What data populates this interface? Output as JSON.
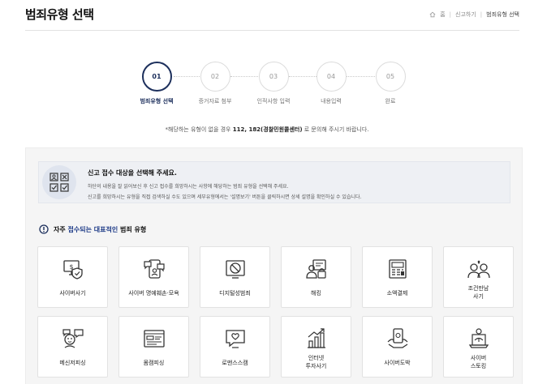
{
  "header": {
    "title": "범죄유형 선택",
    "breadcrumb": [
      "홈",
      "신고하기",
      "범죄유형 선택"
    ]
  },
  "stepper": {
    "steps": [
      {
        "number": "01",
        "label": "범죄유형 선택",
        "active": true
      },
      {
        "number": "02",
        "label": "증거자료 첨부",
        "active": false
      },
      {
        "number": "03",
        "label": "인적사항 입력",
        "active": false
      },
      {
        "number": "04",
        "label": "내용입력",
        "active": false
      },
      {
        "number": "05",
        "label": "완료",
        "active": false
      }
    ]
  },
  "notice": {
    "prefix": "*해당하는 유형이 없을 경우 ",
    "highlight": "112, 182(경찰민원콜센터)",
    "suffix": " 로 문의해 주시기 바랍니다."
  },
  "guide": {
    "title": "신고 접수 대상을 선택해 주세요.",
    "line1": "하단의 내용을 잘 읽어보신 후 신고 접수를 희망하시는 사항에 해당하는 범죄 유형을 선택해 주세요.",
    "line2": "신고를 희망하시는 유형을 직접 검색하실 수도 있으며 세부유형에서는 '설명보기' 버튼을 클릭하시면 상세 설명을 확인하실 수 있습니다."
  },
  "section": {
    "title_prefix": "자주 ",
    "title_highlight": "접수되는 대표적인",
    "title_suffix": " 범죄 유형"
  },
  "categories": [
    {
      "label": "사이버사기",
      "icon": "cyber-fraud-icon"
    },
    {
      "label": "사이버 명예훼손·모욕",
      "icon": "defamation-icon"
    },
    {
      "label": "디지털성범죄",
      "icon": "digital-sex-crime-icon"
    },
    {
      "label": "해킹",
      "icon": "hacking-icon"
    },
    {
      "label": "소액결제",
      "icon": "micropayment-icon"
    },
    {
      "label": "조건만남\n사기",
      "icon": "dating-fraud-icon"
    },
    {
      "label": "메신저피싱",
      "icon": "messenger-phishing-icon"
    },
    {
      "label": "몸캠피싱",
      "icon": "bodycam-phishing-icon"
    },
    {
      "label": "로맨스스캠",
      "icon": "romance-scam-icon"
    },
    {
      "label": "인터넷\n투자사기",
      "icon": "investment-fraud-icon"
    },
    {
      "label": "사이버도박",
      "icon": "cyber-gambling-icon"
    },
    {
      "label": "사이버\n스토킹",
      "icon": "cyber-stalking-icon"
    }
  ],
  "colors": {
    "primary": "#1c2f5c",
    "highlight": "#1f3c88",
    "icon_stroke": "#333333",
    "alert": "#1c2f5c"
  }
}
